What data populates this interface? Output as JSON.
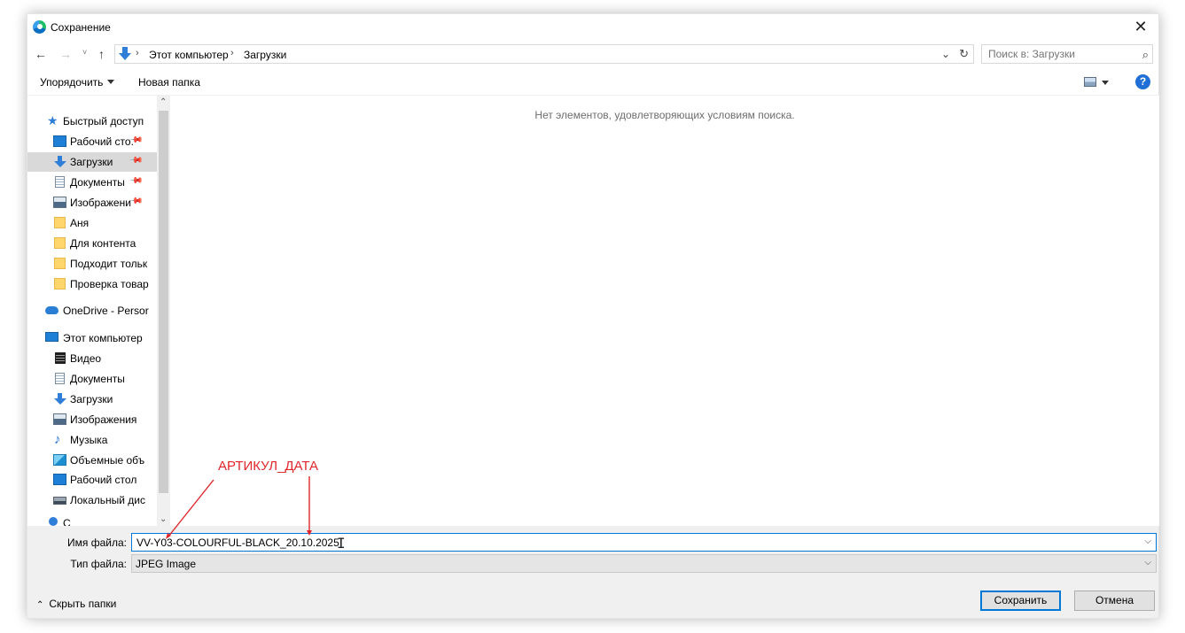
{
  "window": {
    "title": "Сохранение",
    "close_glyph": "✕"
  },
  "navigation": {
    "back_glyph": "←",
    "forward_glyph": "→",
    "recent_glyph": "˅",
    "up_glyph": "↑",
    "breadcrumb": [
      "Этот компьютер",
      "Загрузки"
    ],
    "separator": "›",
    "dropdown_glyph": "⌄",
    "refresh_glyph": "↻",
    "search_placeholder": "Поиск в: Загрузки",
    "search_glyph": "⌕"
  },
  "toolbar": {
    "organize_label": "Упорядочить",
    "new_folder_label": "Новая папка",
    "help_label": "?"
  },
  "sidebar": {
    "items": [
      {
        "label": "Быстрый доступ",
        "icon": "star-icon"
      },
      {
        "label": "Рабочий сто.",
        "icon": "desktop-icon",
        "pinned": true
      },
      {
        "label": "Загрузки",
        "icon": "downloads-icon",
        "pinned": true,
        "selected": true
      },
      {
        "label": "Документы",
        "icon": "documents-icon",
        "pinned": true
      },
      {
        "label": "Изображени",
        "icon": "pictures-icon",
        "pinned": true
      },
      {
        "label": "Аня",
        "icon": "folder-icon"
      },
      {
        "label": "Для контента",
        "icon": "folder-icon"
      },
      {
        "label": "Подходит тольк",
        "icon": "folder-icon"
      },
      {
        "label": "Проверка товар",
        "icon": "folder-icon"
      },
      {
        "label": "OneDrive - Persor",
        "icon": "onedrive-icon"
      },
      {
        "label": "Этот компьютер",
        "icon": "computer-icon"
      },
      {
        "label": "Видео",
        "icon": "video-icon"
      },
      {
        "label": "Документы",
        "icon": "documents-icon"
      },
      {
        "label": "Загрузки",
        "icon": "downloads-icon"
      },
      {
        "label": "Изображения",
        "icon": "pictures-icon"
      },
      {
        "label": "Музыка",
        "icon": "music-icon"
      },
      {
        "label": "Объемные объ",
        "icon": "3d-objects-icon"
      },
      {
        "label": "Рабочий стол",
        "icon": "desktop-icon"
      },
      {
        "label": "Локальный дис",
        "icon": "drive-icon"
      },
      {
        "label": "С",
        "icon": "network-icon"
      }
    ],
    "pin_glyph": "📌"
  },
  "content": {
    "empty_message": "Нет элементов, удовлетворяющих условиям поиска."
  },
  "form": {
    "filename_label": "Имя файла:",
    "filename_value": "VV-Y03-COLOURFUL-BLACK_20.10.2025",
    "filetype_label": "Тип файла:",
    "filetype_value": "JPEG Image",
    "dropdown_glyph": "⌵"
  },
  "footer": {
    "hide_folders_label": "Скрыть папки",
    "hide_folders_glyph": "⌃",
    "save_label": "Сохранить",
    "cancel_label": "Отмена"
  },
  "annotation": {
    "text": "АРТИКУЛ_ДАТА",
    "color": "#e0262b"
  },
  "colors": {
    "accent": "#0078d7",
    "selection": "#d9d9d9",
    "dialog_bg": "#f0f0f0"
  }
}
